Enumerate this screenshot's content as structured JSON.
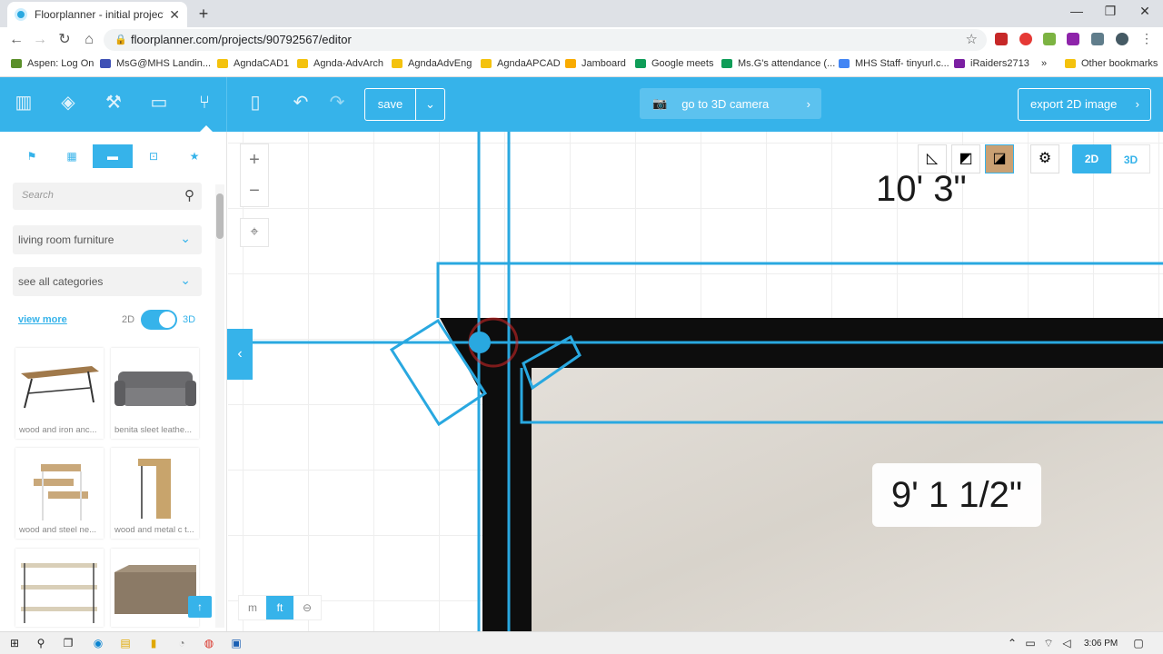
{
  "browser": {
    "tab_title": "Floorplanner - initial project setu",
    "url": "floorplanner.com/projects/90792567/editor",
    "bookmarks": [
      {
        "label": "Aspen: Log On",
        "color": "#5a8f29"
      },
      {
        "label": "MsG@MHS Landin...",
        "color": "#3f51b5"
      },
      {
        "label": "AgndaCAD1",
        "color": "#f4c20d"
      },
      {
        "label": "Agnda-AdvArch",
        "color": "#f4c20d"
      },
      {
        "label": "AgndaAdvEng",
        "color": "#f4c20d"
      },
      {
        "label": "AgndaAPCAD",
        "color": "#f4c20d"
      },
      {
        "label": "Jamboard",
        "color": "#f9ab00"
      },
      {
        "label": "Google meets",
        "color": "#0f9d58"
      },
      {
        "label": "Ms.G's attendance (...",
        "color": "#0f9d58"
      },
      {
        "label": "MHS Staff- tinyurl.c...",
        "color": "#4285f4"
      },
      {
        "label": "iRaiders2713",
        "color": "#7b1fa2"
      },
      {
        "label": "»",
        "color": ""
      },
      {
        "label": "Other bookmarks",
        "color": "#f4c20d"
      }
    ]
  },
  "header": {
    "save_label": "save",
    "camera_label": "go to 3D camera",
    "export_label": "export 2D image",
    "accent": "#36b3ea"
  },
  "sidebar": {
    "search_placeholder": "Search",
    "category_dropdown": "living room furniture",
    "all_categories_dropdown": "see all categories",
    "view_more": "view more",
    "toggle_2d": "2D",
    "toggle_3d": "3D",
    "items": [
      {
        "caption": "wood and iron anc..."
      },
      {
        "caption": "benita sleet leathe..."
      },
      {
        "caption": "wood and steel ne..."
      },
      {
        "caption": "wood and metal c t..."
      },
      {
        "caption": ""
      },
      {
        "caption": ""
      }
    ]
  },
  "canvas": {
    "dimension_top": "10' 3\"",
    "dimension_mid": "9' 1 1/2\"",
    "view_2d": "2D",
    "view_3d": "3D",
    "unit_m": "m",
    "unit_ft": "ft"
  },
  "taskbar": {
    "time": "3:06 PM"
  }
}
